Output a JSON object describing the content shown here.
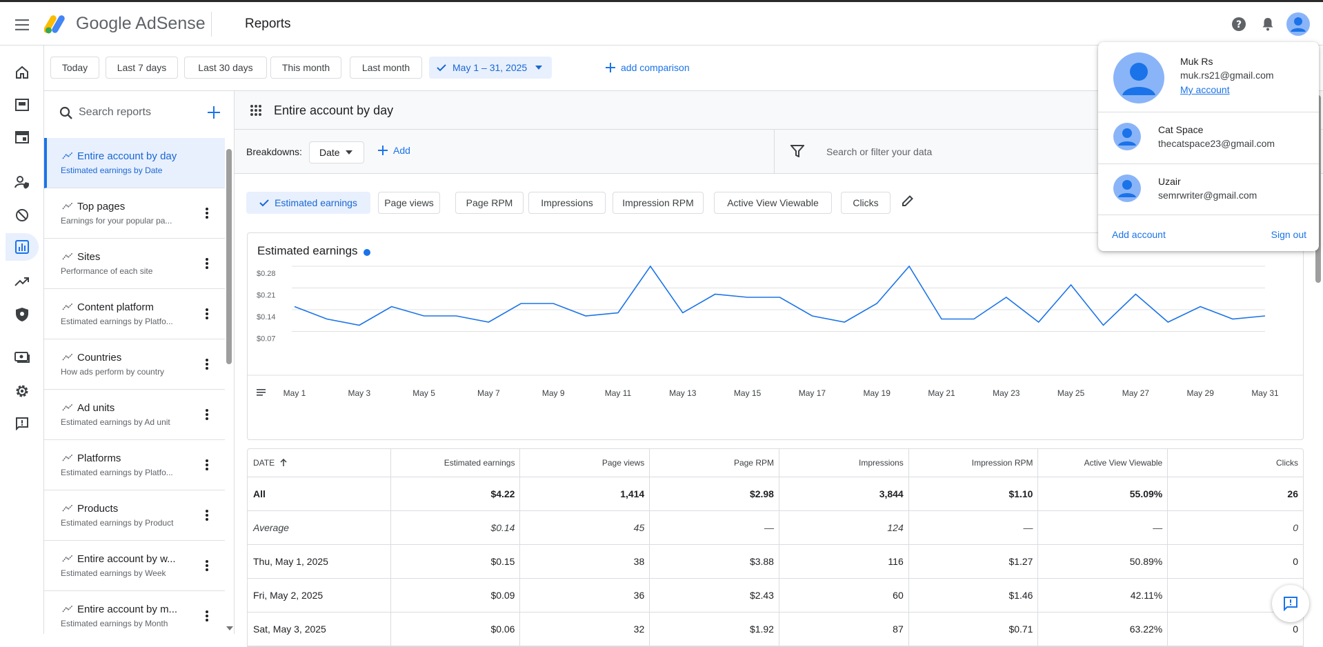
{
  "header": {
    "brand": "Google AdSense",
    "page_title": "Reports"
  },
  "date_range": {
    "presets": [
      "Today",
      "Last 7 days",
      "Last 30 days",
      "This month",
      "Last month"
    ],
    "selected": "May 1 – 31, 2025",
    "add_comparison": "add comparison"
  },
  "sidebar": {
    "search_placeholder": "Search reports",
    "reports": [
      {
        "title": "Entire account by day",
        "subtitle": "Estimated earnings by Date",
        "active": true
      },
      {
        "title": "Top pages",
        "subtitle": "Earnings for your popular pa..."
      },
      {
        "title": "Sites",
        "subtitle": "Performance of each site"
      },
      {
        "title": "Content platform",
        "subtitle": "Estimated earnings by Platfo..."
      },
      {
        "title": "Countries",
        "subtitle": "How ads perform by country"
      },
      {
        "title": "Ad units",
        "subtitle": "Estimated earnings by Ad unit"
      },
      {
        "title": "Platforms",
        "subtitle": "Estimated earnings by Platfo..."
      },
      {
        "title": "Products",
        "subtitle": "Estimated earnings by Product"
      },
      {
        "title": "Entire account by w...",
        "subtitle": "Estimated earnings by Week"
      },
      {
        "title": "Entire account by m...",
        "subtitle": "Estimated earnings by Month"
      }
    ]
  },
  "report": {
    "title": "Entire account by day",
    "breakdowns_label": "Breakdowns:",
    "breakdown_value": "Date",
    "add_label": "Add",
    "filter_placeholder": "Search or filter your data",
    "metrics": [
      "Estimated earnings",
      "Page views",
      "Page RPM",
      "Impressions",
      "Impression RPM",
      "Active View Viewable",
      "Clicks"
    ],
    "selected_metric": "Estimated earnings"
  },
  "chart_data": {
    "type": "line",
    "title": "Estimated earnings",
    "series": [
      {
        "name": "",
        "color": "#1a73e8",
        "values": [
          0.15,
          0.11,
          0.09,
          0.15,
          0.12,
          0.12,
          0.1,
          0.16,
          0.16,
          0.12,
          0.13,
          0.28,
          0.13,
          0.19,
          0.18,
          0.18,
          0.12,
          0.1,
          0.16,
          0.28,
          0.11,
          0.11,
          0.18,
          0.1,
          0.22,
          0.09,
          0.19,
          0.1,
          0.15,
          0.11,
          0.12
        ]
      }
    ],
    "x_tick_labels": [
      "May 1",
      "May 3",
      "May 5",
      "May 7",
      "May 9",
      "May 11",
      "May 13",
      "May 15",
      "May 17",
      "May 19",
      "May 21",
      "May 23",
      "May 25",
      "May 27",
      "May 29",
      "May 31"
    ],
    "y_ticks": [
      0.07,
      0.14,
      0.21,
      0.28
    ],
    "y_tick_labels": [
      "$0.07",
      "$0.14",
      "$0.21",
      "$0.28"
    ],
    "ylim": [
      0.0,
      0.28
    ],
    "grid": true
  },
  "table": {
    "columns": [
      "DATE",
      "Estimated earnings",
      "Page views",
      "Page RPM",
      "Impressions",
      "Impression RPM",
      "Active View Viewable",
      "Clicks"
    ],
    "rows": [
      {
        "kind": "all",
        "cells": [
          "All",
          "$4.22",
          "1,414",
          "$2.98",
          "3,844",
          "$1.10",
          "55.09%",
          "26"
        ]
      },
      {
        "kind": "avg",
        "cells": [
          "Average",
          "$0.14",
          "45",
          "—",
          "124",
          "—",
          "—",
          "0"
        ]
      },
      {
        "kind": "day",
        "cells": [
          "Thu, May 1, 2025",
          "$0.15",
          "38",
          "$3.88",
          "116",
          "$1.27",
          "50.89%",
          "0"
        ]
      },
      {
        "kind": "day",
        "cells": [
          "Fri, May 2, 2025",
          "$0.09",
          "36",
          "$2.43",
          "60",
          "$1.46",
          "42.11%",
          ""
        ]
      },
      {
        "kind": "day",
        "cells": [
          "Sat, May 3, 2025",
          "$0.06",
          "32",
          "$1.92",
          "87",
          "$0.71",
          "63.22%",
          "0"
        ]
      }
    ]
  },
  "account_menu": {
    "primary": {
      "name": "Muk Rs",
      "email": "muk.rs21@gmail.com",
      "link": "My account"
    },
    "others": [
      {
        "name": "Cat Space",
        "email": "thecatspace23@gmail.com"
      },
      {
        "name": "Uzair",
        "email": "semrwriter@gmail.com"
      }
    ],
    "add_account": "Add account",
    "sign_out": "Sign out"
  }
}
